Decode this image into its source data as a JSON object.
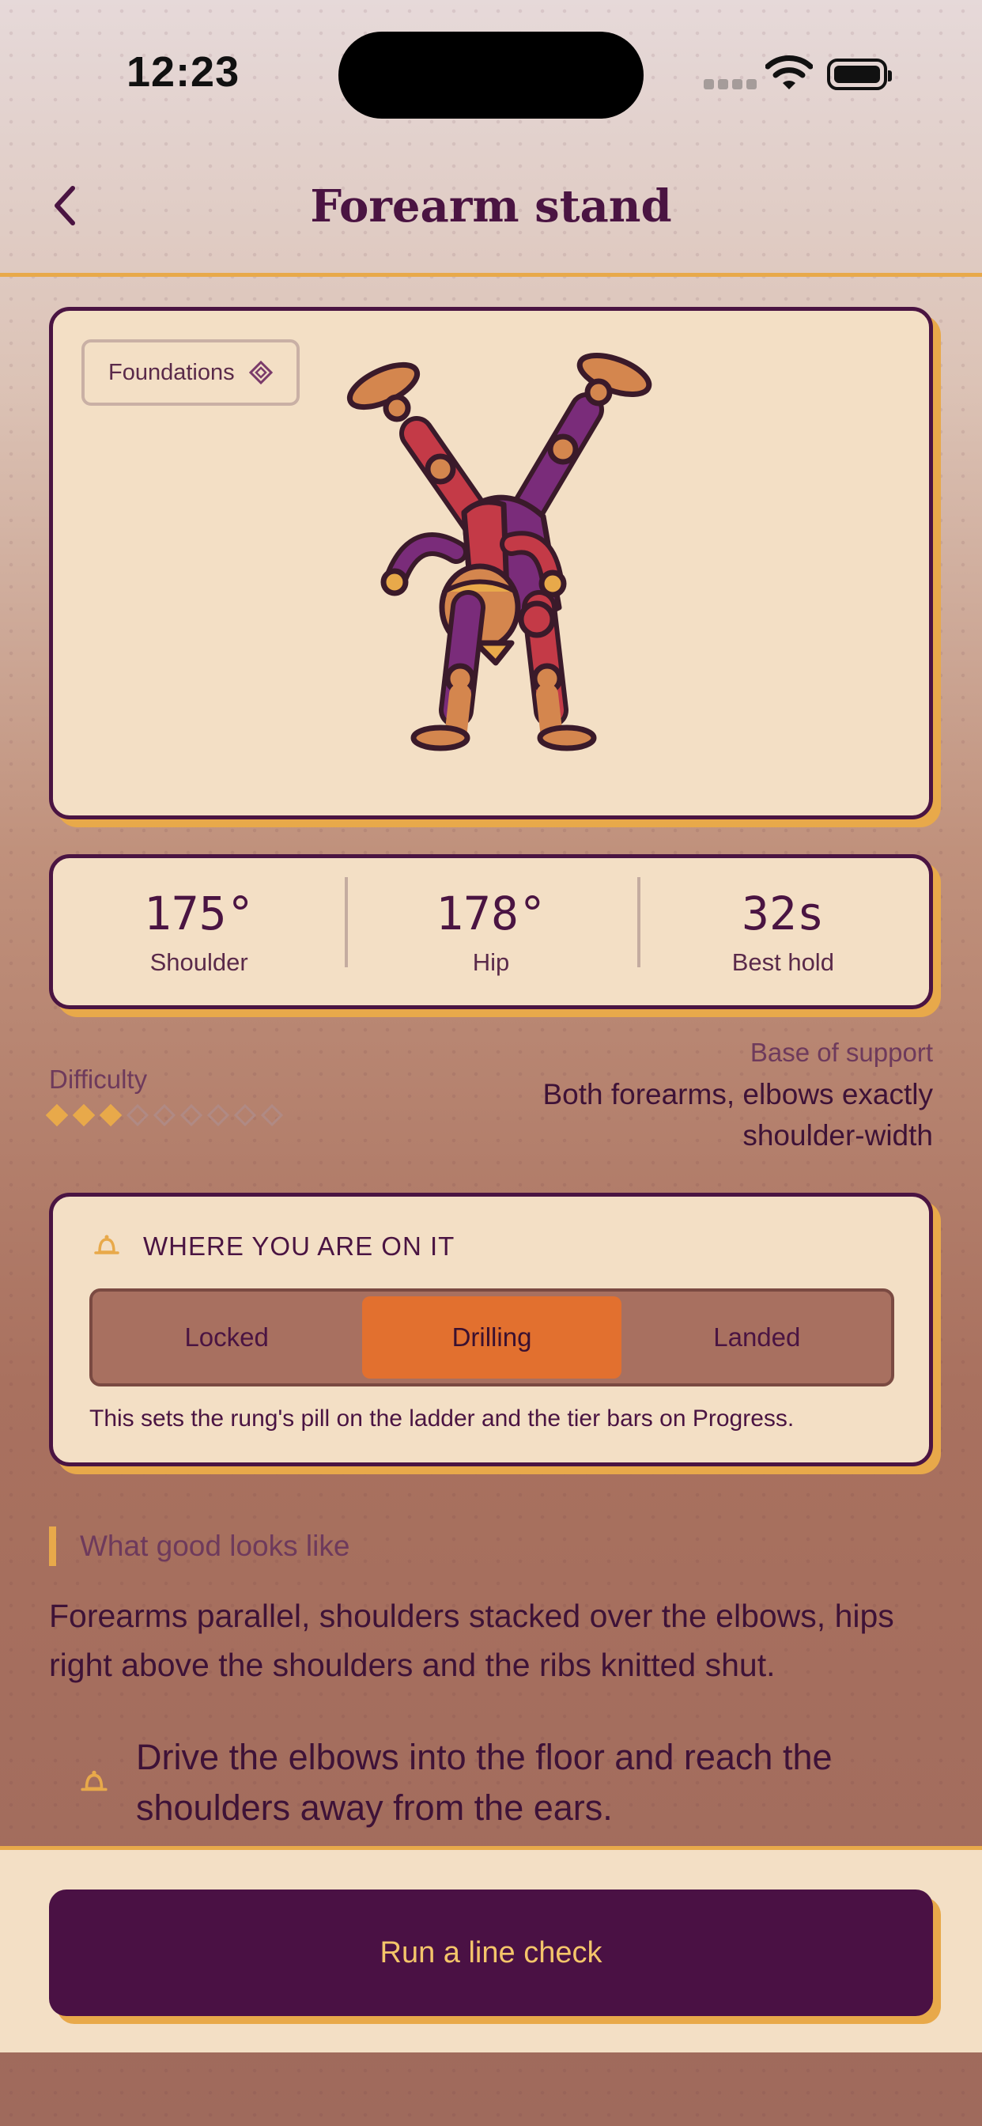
{
  "status_bar": {
    "time": "12:23"
  },
  "header": {
    "title": "Forearm stand",
    "back_icon": "chevron-left-icon"
  },
  "hero": {
    "tag_label": "Foundations",
    "tag_icon": "diamond-icon",
    "image": "jester-forearm-stand-illustration"
  },
  "stats": [
    {
      "value": "175°",
      "label": "Shoulder"
    },
    {
      "value": "178°",
      "label": "Hip"
    },
    {
      "value": "32s",
      "label": "Best hold"
    }
  ],
  "difficulty": {
    "label": "Difficulty",
    "level": 3,
    "max": 9
  },
  "base_of_support": {
    "label": "Base of support",
    "text_line1": "Both forearms, elbows exactly",
    "text_line2": "shoulder-width"
  },
  "where": {
    "heading": "WHERE YOU ARE ON IT",
    "heading_icon": "bell-icon",
    "options": [
      "Locked",
      "Drilling",
      "Landed"
    ],
    "selected": "Drilling",
    "note": "This sets the rung's pill on the ladder and the tier bars on Progress."
  },
  "good": {
    "heading": "What good looks like",
    "text_line1": "Forearms parallel, shoulders stacked over the elbows, hips",
    "text_line2": "right above the shoulders and the ribs knitted shut.",
    "cue_icon": "bell-icon",
    "cue_line1": "Drive the elbows into the floor and reach the",
    "cue_line2": "shoulders away from the ears."
  },
  "cta": {
    "label": "Run a line check"
  },
  "colors": {
    "accent": "#e8a94a",
    "primary": "#4a1144",
    "active_segment": "#e2702f",
    "card": "#f3dfc5"
  }
}
